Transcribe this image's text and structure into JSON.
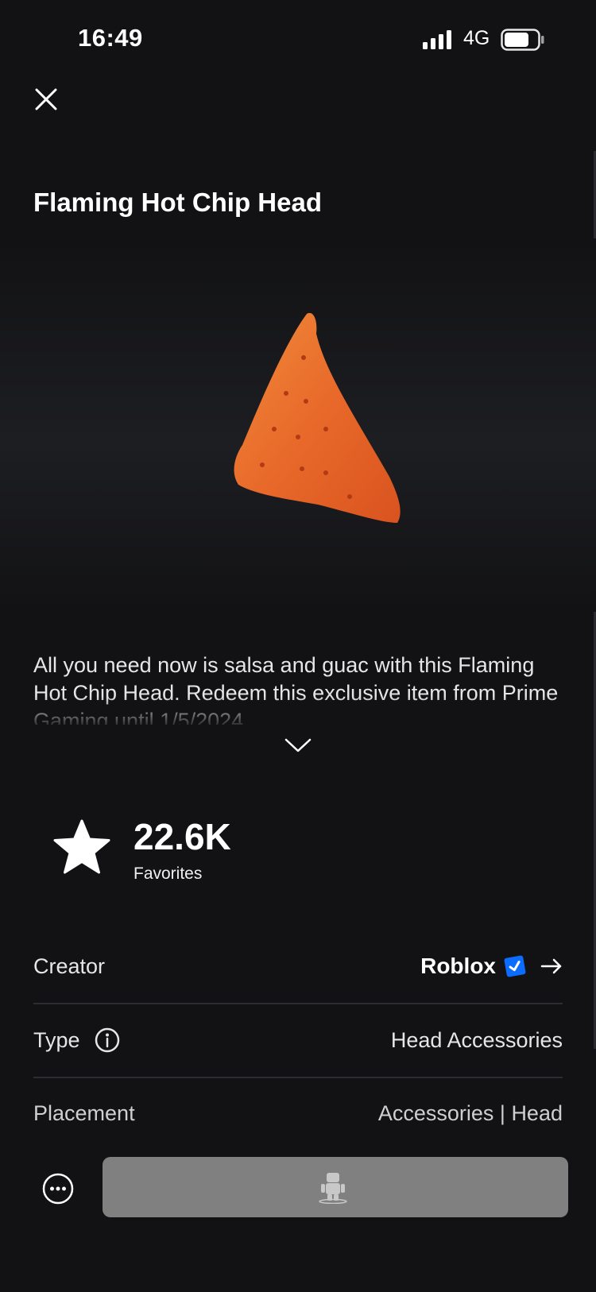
{
  "status_bar": {
    "time": "16:49",
    "network": "4G",
    "battery_level": 0.75,
    "signal_bars": 4
  },
  "header": {
    "close_icon": "close-icon"
  },
  "item": {
    "title": "Flaming Hot Chip Head",
    "description": "All you need now is salsa and guac with this Flaming Hot Chip Head. Redeem this exclusive item from Prime Gaming until 1/5/2024.",
    "expand_icon": "chevron-down-icon"
  },
  "favorites": {
    "count": "22.6K",
    "label": "Favorites",
    "icon": "star-icon"
  },
  "details": {
    "creator": {
      "label": "Creator",
      "value": "Roblox",
      "verified": true,
      "accent": "#0b6cff"
    },
    "type": {
      "label": "Type",
      "value": "Head Accessories"
    },
    "placement": {
      "label": "Placement",
      "value": "Accessories | Head"
    }
  },
  "actions": {
    "more_icon": "more-icon",
    "try_on_icon": "avatar-icon",
    "button_color": "#808080"
  }
}
